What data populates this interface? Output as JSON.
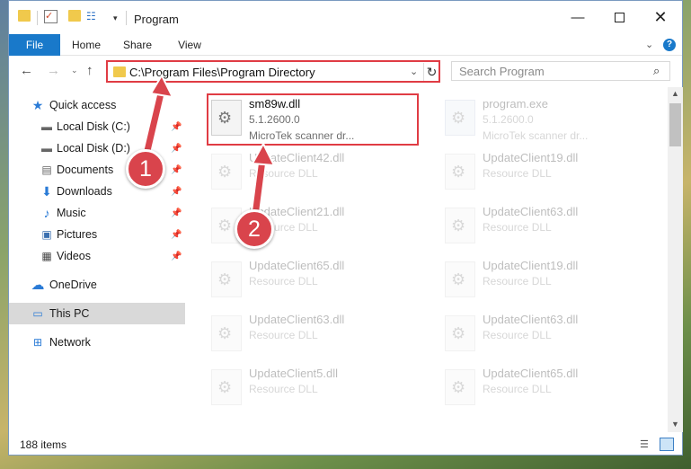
{
  "window": {
    "title": "Program",
    "controls": {
      "minimize": "—",
      "maximize": "",
      "close": "✕"
    }
  },
  "ribbon": {
    "tabs": [
      "File",
      "Home",
      "Share",
      "View"
    ]
  },
  "nav": {
    "address": "C:\\Program Files\\Program Directory",
    "search_placeholder": "Search Program"
  },
  "sidebar": {
    "items": [
      {
        "label": "Quick access",
        "icon": "star-icon",
        "pinned": false,
        "selected": false
      },
      {
        "label": "Local Disk (C:)",
        "icon": "drive-icon",
        "pinned": true,
        "selected": false
      },
      {
        "label": "Local Disk (D:)",
        "icon": "drive-icon",
        "pinned": true,
        "selected": false
      },
      {
        "label": "Documents",
        "icon": "documents-icon",
        "pinned": true,
        "selected": false
      },
      {
        "label": "Downloads",
        "icon": "download-icon",
        "pinned": true,
        "selected": false
      },
      {
        "label": "Music",
        "icon": "music-icon",
        "pinned": true,
        "selected": false
      },
      {
        "label": "Pictures",
        "icon": "pictures-icon",
        "pinned": true,
        "selected": false
      },
      {
        "label": "Videos",
        "icon": "video-icon",
        "pinned": true,
        "selected": false
      },
      {
        "label": "OneDrive",
        "icon": "cloud-icon",
        "pinned": false,
        "selected": false
      },
      {
        "label": "This PC",
        "icon": "computer-icon",
        "pinned": false,
        "selected": true
      },
      {
        "label": "Network",
        "icon": "network-icon",
        "pinned": false,
        "selected": false
      }
    ]
  },
  "files": [
    {
      "name": "sm89w.dll",
      "version": "5.1.2600.0",
      "desc": "MicroTek scanner dr...",
      "highlighted": true
    },
    {
      "name": "program.exe",
      "version": "5.1.2600.0",
      "desc": "MicroTek scanner dr...",
      "faded": true
    },
    {
      "name": "UpdateClient42.dll",
      "version": "Resource DLL",
      "faded": true
    },
    {
      "name": "UpdateClient19.dll",
      "version": "Resource DLL",
      "faded": true
    },
    {
      "name": "UpdateClient21.dll",
      "version": "Resource DLL",
      "faded": true
    },
    {
      "name": "UpdateClient63.dll",
      "version": "Resource DLL",
      "faded": true
    },
    {
      "name": "UpdateClient65.dll",
      "version": "Resource DLL",
      "faded": true
    },
    {
      "name": "UpdateClient19.dll",
      "version": "Resource DLL",
      "faded": true
    },
    {
      "name": "UpdateClient63.dll",
      "version": "Resource DLL",
      "faded": true
    },
    {
      "name": "UpdateClient63.dll",
      "version": "Resource DLL",
      "faded": true
    },
    {
      "name": "UpdateClient5.dll",
      "version": "Resource DLL",
      "faded": true
    },
    {
      "name": "UpdateClient65.dll",
      "version": "Resource DLL",
      "faded": true
    }
  ],
  "status": {
    "item_count": "188 items"
  },
  "annotations": {
    "step1": "1",
    "step2": "2",
    "accent": "#d9444c"
  },
  "colors": {
    "file_tab": "#1979ca",
    "highlight": "#e03c44",
    "selected_nav": "#d9d9d9"
  }
}
